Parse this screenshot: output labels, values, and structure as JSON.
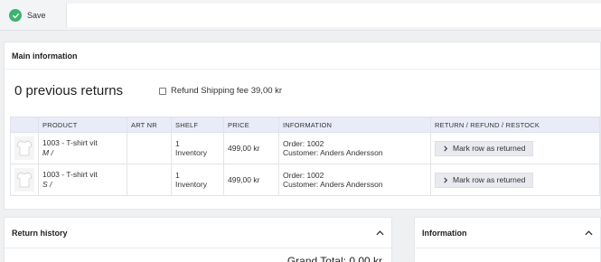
{
  "toolbar": {
    "save_label": "Save"
  },
  "main": {
    "title": "Main information",
    "previous_returns": "0 previous returns",
    "refund_shipping_label": "Refund Shipping fee 39,00 kr",
    "columns": [
      "",
      "PRODUCT",
      "ART NR",
      "SHELF",
      "PRICE",
      "INFORMATION",
      "RETURN / REFUND / RESTOCK"
    ],
    "rows": [
      {
        "product": "1003 - T-shirt vit",
        "variant": "M /",
        "art_nr": "",
        "shelf_num": "1",
        "shelf_loc": "Inventory",
        "price": "499,00 kr",
        "order": "Order: 1002",
        "customer": "Customer: Anders Andersson",
        "action": "Mark row as returned"
      },
      {
        "product": "1003 - T-shirt vit",
        "variant": "S /",
        "art_nr": "",
        "shelf_num": "1",
        "shelf_loc": "Inventory",
        "price": "499,00 kr",
        "order": "Order: 1002",
        "customer": "Customer: Anders Andersson",
        "action": "Mark row as returned"
      }
    ]
  },
  "history": {
    "title": "Return history",
    "grand_total": "Grand Total: 0,00 kr"
  },
  "info": {
    "title": "Information"
  },
  "icons": {
    "save": "check-circle-icon",
    "expand": "chevron-up-icon",
    "row_action": "chevron-right-icon",
    "product": "tshirt-icon"
  },
  "colors": {
    "save_check": "#3cb371",
    "table_header": "#e9ecf8",
    "action_button": "#e8eaf0"
  }
}
